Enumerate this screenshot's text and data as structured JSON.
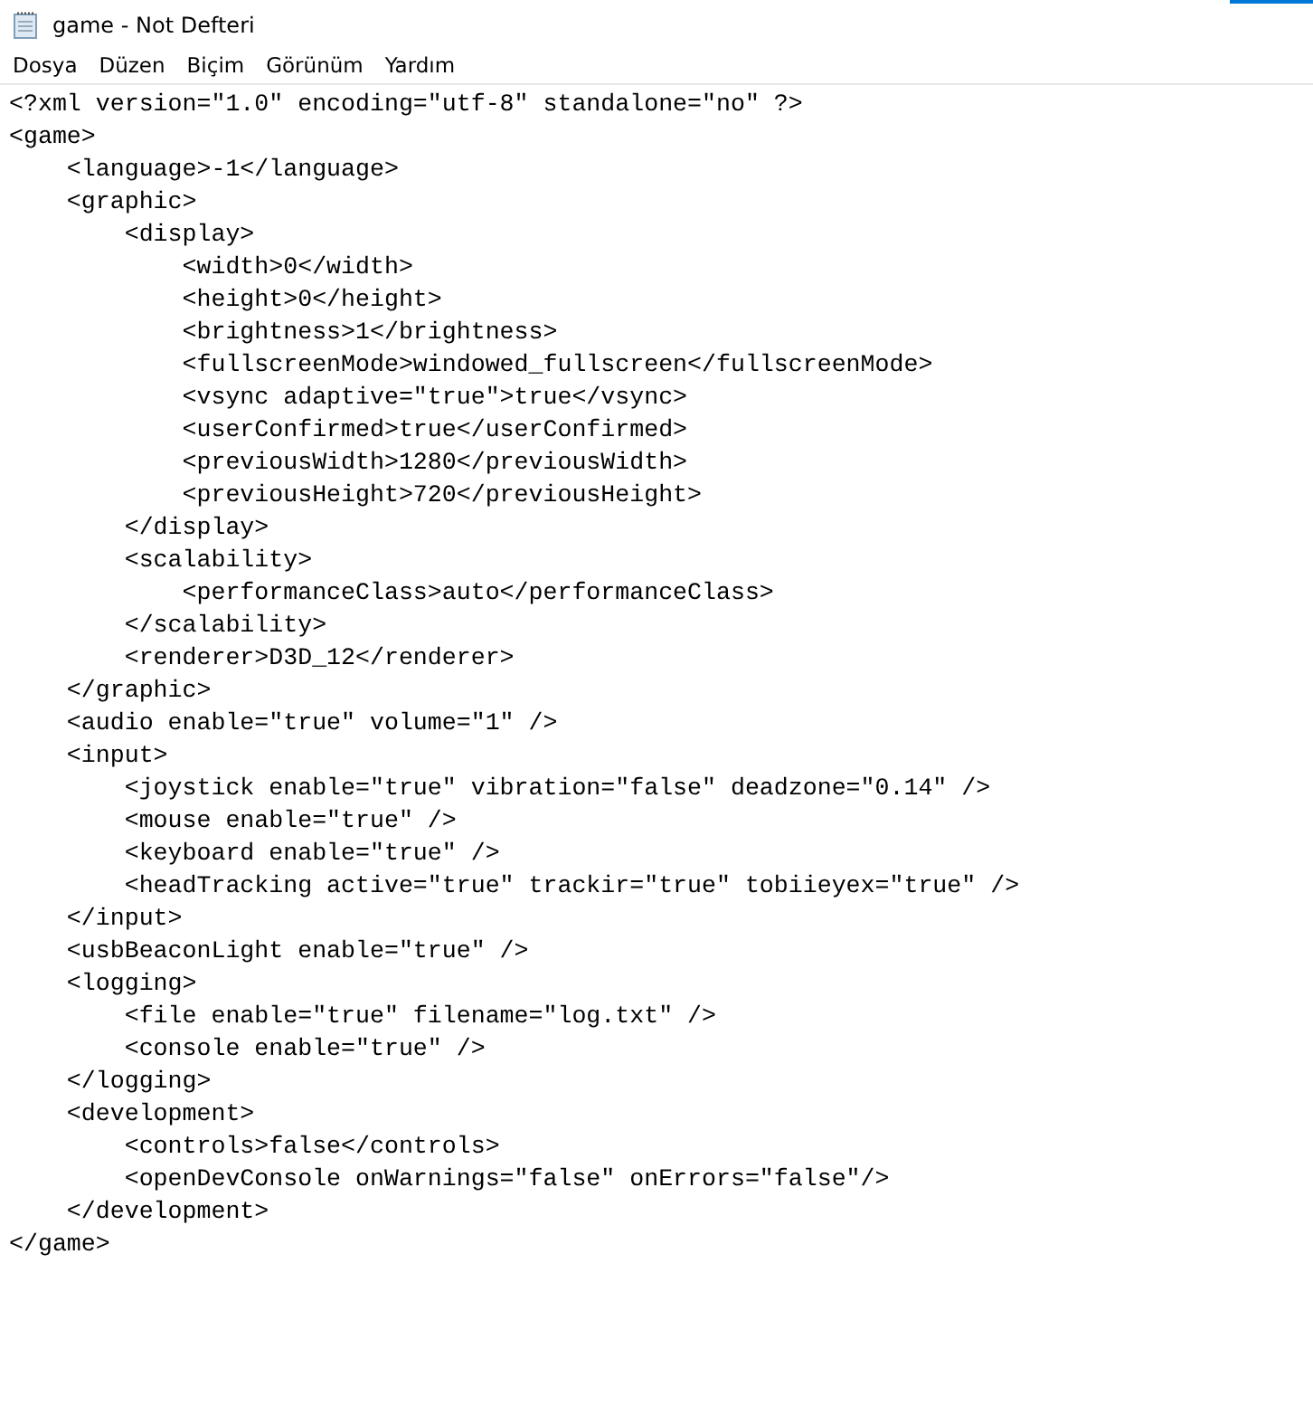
{
  "window": {
    "title": "game - Not Defteri"
  },
  "menu": [
    "Dosya",
    "Düzen",
    "Biçim",
    "Görünüm",
    "Yardım"
  ],
  "editor": {
    "lines": [
      "<?xml version=\"1.0\" encoding=\"utf-8\" standalone=\"no\" ?>",
      "<game>",
      "    <language>-1</language>",
      "    <graphic>",
      "        <display>",
      "            <width>0</width>",
      "            <height>0</height>",
      "            <brightness>1</brightness>",
      "            <fullscreenMode>windowed_fullscreen</fullscreenMode>",
      "            <vsync adaptive=\"true\">true</vsync>",
      "            <userConfirmed>true</userConfirmed>",
      "            <previousWidth>1280</previousWidth>",
      "            <previousHeight>720</previousHeight>",
      "        </display>",
      "        <scalability>",
      "            <performanceClass>auto</performanceClass>",
      "        </scalability>",
      "        <renderer>D3D_12</renderer>",
      "    </graphic>",
      "    <audio enable=\"true\" volume=\"1\" />",
      "    <input>",
      "        <joystick enable=\"true\" vibration=\"false\" deadzone=\"0.14\" />",
      "        <mouse enable=\"true\" />",
      "        <keyboard enable=\"true\" />",
      "        <headTracking active=\"true\" trackir=\"true\" tobiieyex=\"true\" />",
      "    </input>",
      "    <usbBeaconLight enable=\"true\" />",
      "    <logging>",
      "        <file enable=\"true\" filename=\"log.txt\" />",
      "        <console enable=\"true\" />",
      "    </logging>",
      "    <development>",
      "        <controls>false</controls>",
      "        <openDevConsole onWarnings=\"false\" onErrors=\"false\"/>",
      "    </development>",
      "</game>"
    ]
  }
}
